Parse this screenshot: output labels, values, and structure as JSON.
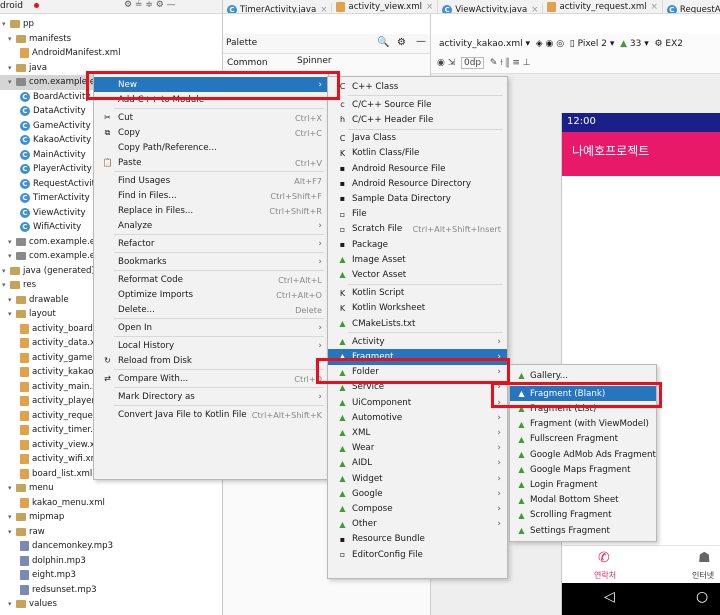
{
  "project": {
    "header": "droid",
    "tree": [
      {
        "label": "pp",
        "icon": "folder",
        "indent": 0
      },
      {
        "label": "manifests",
        "icon": "folder",
        "indent": 1
      },
      {
        "label": "AndroidManifest.xml",
        "icon": "xml",
        "indent": 2
      },
      {
        "label": "java",
        "icon": "folder",
        "indent": 1
      },
      {
        "label": "com.example.ex2",
        "icon": "pkg",
        "indent": 1,
        "selected": true
      },
      {
        "label": "BoardActivity",
        "icon": "c",
        "indent": 2
      },
      {
        "label": "DataActivity",
        "icon": "c",
        "indent": 2
      },
      {
        "label": "GameActivity",
        "icon": "c",
        "indent": 2
      },
      {
        "label": "KakaoActivity",
        "icon": "c",
        "indent": 2
      },
      {
        "label": "MainActivity",
        "icon": "c",
        "indent": 2
      },
      {
        "label": "PlayerActivity",
        "icon": "c",
        "indent": 2
      },
      {
        "label": "RequestActivity",
        "icon": "c",
        "indent": 2
      },
      {
        "label": "TimerActivity",
        "icon": "c",
        "indent": 2
      },
      {
        "label": "ViewActivity",
        "icon": "c",
        "indent": 2
      },
      {
        "label": "WifiActivity",
        "icon": "c",
        "indent": 2
      },
      {
        "label": "com.example.ex22",
        "icon": "pkg",
        "indent": 1
      },
      {
        "label": "com.example.ex22",
        "icon": "pkg",
        "indent": 1
      },
      {
        "label": "java (generated)",
        "icon": "folder",
        "indent": 0
      },
      {
        "label": "res",
        "icon": "folder",
        "indent": 0
      },
      {
        "label": "drawable",
        "icon": "folder",
        "indent": 1
      },
      {
        "label": "layout",
        "icon": "folder",
        "indent": 1
      },
      {
        "label": "activity_board.x",
        "icon": "xml",
        "indent": 2
      },
      {
        "label": "activity_data.xn",
        "icon": "xml",
        "indent": 2
      },
      {
        "label": "activity_game.x",
        "icon": "xml",
        "indent": 2
      },
      {
        "label": "activity_kakao.x",
        "icon": "xml",
        "indent": 2
      },
      {
        "label": "activity_main.x",
        "icon": "xml",
        "indent": 2
      },
      {
        "label": "activity_player.x",
        "icon": "xml",
        "indent": 2
      },
      {
        "label": "activity_request",
        "icon": "xml",
        "indent": 2
      },
      {
        "label": "activity_timer.x",
        "icon": "xml",
        "indent": 2
      },
      {
        "label": "activity_view.xm",
        "icon": "xml",
        "indent": 2
      },
      {
        "label": "activity_wifi.xm",
        "icon": "xml",
        "indent": 2
      },
      {
        "label": "board_list.xml",
        "icon": "xml",
        "indent": 2
      },
      {
        "label": "menu",
        "icon": "folder",
        "indent": 1
      },
      {
        "label": "kakao_menu.xml",
        "icon": "xml",
        "indent": 2
      },
      {
        "label": "mipmap",
        "icon": "folder",
        "indent": 1
      },
      {
        "label": "raw",
        "icon": "folder",
        "indent": 1
      },
      {
        "label": "dancemonkey.mp3",
        "icon": "mp3",
        "indent": 2
      },
      {
        "label": "dolphin.mp3",
        "icon": "mp3",
        "indent": 2
      },
      {
        "label": "eight.mp3",
        "icon": "mp3",
        "indent": 2
      },
      {
        "label": "redsunset.mp3",
        "icon": "mp3",
        "indent": 2
      },
      {
        "label": "values",
        "icon": "folder",
        "indent": 1
      }
    ]
  },
  "tabs": [
    "TimerActivity.java",
    "activity_view.xml",
    "ViewActivity.java",
    "activity_request.xml",
    "RequestActivity"
  ],
  "palette": {
    "title": "Palette",
    "category": "Common",
    "item": "Spinner"
  },
  "design_toolbar": {
    "file": "activity_kakao.xml",
    "device": "Pixel 2",
    "api": "33",
    "extra": "EX2",
    "margin": "0dp"
  },
  "phone": {
    "time": "12:00",
    "app_title": "나예호프로젝트",
    "nav_home": "연락처",
    "nav_person": "인터넷"
  },
  "context_menu": [
    {
      "label": "New",
      "sub": true,
      "highlight": true
    },
    {
      "label": "Add C++ to Module"
    },
    {
      "sep": true
    },
    {
      "label": "Cut",
      "shortcut": "Ctrl+X",
      "icon": "✂"
    },
    {
      "label": "Copy",
      "shortcut": "Ctrl+C",
      "icon": "⧉"
    },
    {
      "label": "Copy Path/Reference..."
    },
    {
      "label": "Paste",
      "shortcut": "Ctrl+V",
      "icon": "📋"
    },
    {
      "sep": true
    },
    {
      "label": "Find Usages",
      "shortcut": "Alt+F7"
    },
    {
      "label": "Find in Files...",
      "shortcut": "Ctrl+Shift+F"
    },
    {
      "label": "Replace in Files...",
      "shortcut": "Ctrl+Shift+R"
    },
    {
      "label": "Analyze",
      "sub": true
    },
    {
      "sep": true
    },
    {
      "label": "Refactor",
      "sub": true
    },
    {
      "sep": true
    },
    {
      "label": "Bookmarks",
      "sub": true
    },
    {
      "sep": true
    },
    {
      "label": "Reformat Code",
      "shortcut": "Ctrl+Alt+L"
    },
    {
      "label": "Optimize Imports",
      "shortcut": "Ctrl+Alt+O"
    },
    {
      "label": "Delete...",
      "shortcut": "Delete"
    },
    {
      "sep": true
    },
    {
      "label": "Open In",
      "sub": true
    },
    {
      "sep": true
    },
    {
      "label": "Local History",
      "sub": true
    },
    {
      "label": "Reload from Disk",
      "icon": "↻"
    },
    {
      "sep": true
    },
    {
      "label": "Compare With...",
      "shortcut": "Ctrl+D",
      "icon": "⇄"
    },
    {
      "sep": true
    },
    {
      "label": "Mark Directory as",
      "sub": true
    },
    {
      "sep": true
    },
    {
      "label": "Convert Java File to Kotlin File",
      "shortcut": "Ctrl+Alt+Shift+K"
    }
  ],
  "new_menu": [
    {
      "label": "C++ Class",
      "icon": "C"
    },
    {
      "sep": true
    },
    {
      "label": "C/C++ Source File",
      "icon": "c"
    },
    {
      "label": "C/C++ Header File",
      "icon": "h"
    },
    {
      "sep": true
    },
    {
      "label": "Java Class",
      "icon": "C"
    },
    {
      "label": "Kotlin Class/File",
      "icon": "K"
    },
    {
      "label": "Android Resource File",
      "icon": "▪"
    },
    {
      "label": "Android Resource Directory",
      "icon": "▪"
    },
    {
      "label": "Sample Data Directory",
      "icon": "▪"
    },
    {
      "label": "File",
      "icon": "▫"
    },
    {
      "label": "Scratch File",
      "shortcut": "Ctrl+Alt+Shift+Insert",
      "icon": "▫"
    },
    {
      "label": "Package",
      "icon": "▪"
    },
    {
      "label": "Image Asset",
      "icon": "▲"
    },
    {
      "label": "Vector Asset",
      "icon": "▲"
    },
    {
      "sep": true
    },
    {
      "label": "Kotlin Script",
      "icon": "K"
    },
    {
      "label": "Kotlin Worksheet",
      "icon": "K"
    },
    {
      "label": "CMakeLists.txt",
      "icon": "▲"
    },
    {
      "sep": true
    },
    {
      "label": "Activity",
      "sub": true,
      "icon": "▲"
    },
    {
      "label": "Fragment",
      "sub": true,
      "highlight": true,
      "icon": "▲"
    },
    {
      "label": "Folder",
      "sub": true,
      "icon": "▲"
    },
    {
      "label": "Service",
      "sub": true,
      "icon": "▲"
    },
    {
      "label": "UiComponent",
      "sub": true,
      "icon": "▲"
    },
    {
      "label": "Automotive",
      "sub": true,
      "icon": "▲"
    },
    {
      "label": "XML",
      "sub": true,
      "icon": "▲"
    },
    {
      "label": "Wear",
      "sub": true,
      "icon": "▲"
    },
    {
      "label": "AIDL",
      "sub": true,
      "icon": "▲"
    },
    {
      "label": "Widget",
      "sub": true,
      "icon": "▲"
    },
    {
      "label": "Google",
      "sub": true,
      "icon": "▲"
    },
    {
      "label": "Compose",
      "sub": true,
      "icon": "▲"
    },
    {
      "label": "Other",
      "sub": true,
      "icon": "▲"
    },
    {
      "label": "Resource Bundle",
      "icon": "▪"
    },
    {
      "label": "EditorConfig File",
      "icon": "▫"
    }
  ],
  "fragment_menu": [
    {
      "label": "Gallery..."
    },
    {
      "sep": true
    },
    {
      "label": "Fragment (Blank)",
      "highlight": true
    },
    {
      "label": "Fragment (List)"
    },
    {
      "label": "Fragment (with ViewModel)"
    },
    {
      "label": "Fullscreen Fragment"
    },
    {
      "label": "Google AdMob Ads Fragment"
    },
    {
      "label": "Google Maps Fragment"
    },
    {
      "label": "Login Fragment"
    },
    {
      "label": "Modal Bottom Sheet"
    },
    {
      "label": "Scrolling Fragment"
    },
    {
      "label": "Settings Fragment"
    }
  ],
  "colors": {
    "highlight": "#2675bf",
    "red_box": "#e8101c",
    "app_bar": "#e9196a",
    "status_bar": "#1a1f8a"
  }
}
